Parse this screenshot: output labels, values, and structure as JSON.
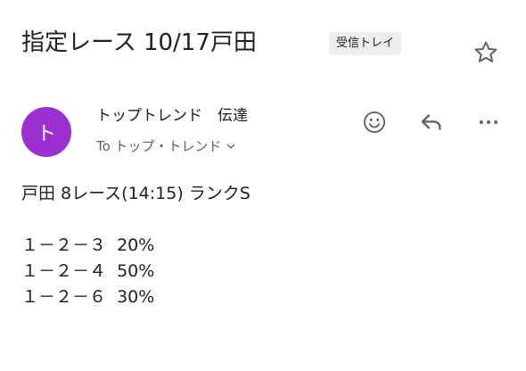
{
  "subject": "指定レース 10/17戸田",
  "label": "受信トレイ",
  "sender": {
    "avatar_letter": "ト",
    "name": "トップトレンド　伝達",
    "recipient": "To トップ・トレンド"
  },
  "icons": {
    "star": "star-outline-icon",
    "emoji": "emoji-reaction-icon",
    "reply": "reply-icon",
    "more": "more-horizontal-icon"
  },
  "colors": {
    "avatar": "#9c2fcf",
    "chip_bg": "#eeeeee",
    "icon": "#5f6368"
  },
  "body": {
    "lines": [
      "戸田 8レース(14:15) ランクS",
      "",
      "１－２－３  20%",
      "１－２－４  50%",
      "１－２－６  30%"
    ]
  }
}
